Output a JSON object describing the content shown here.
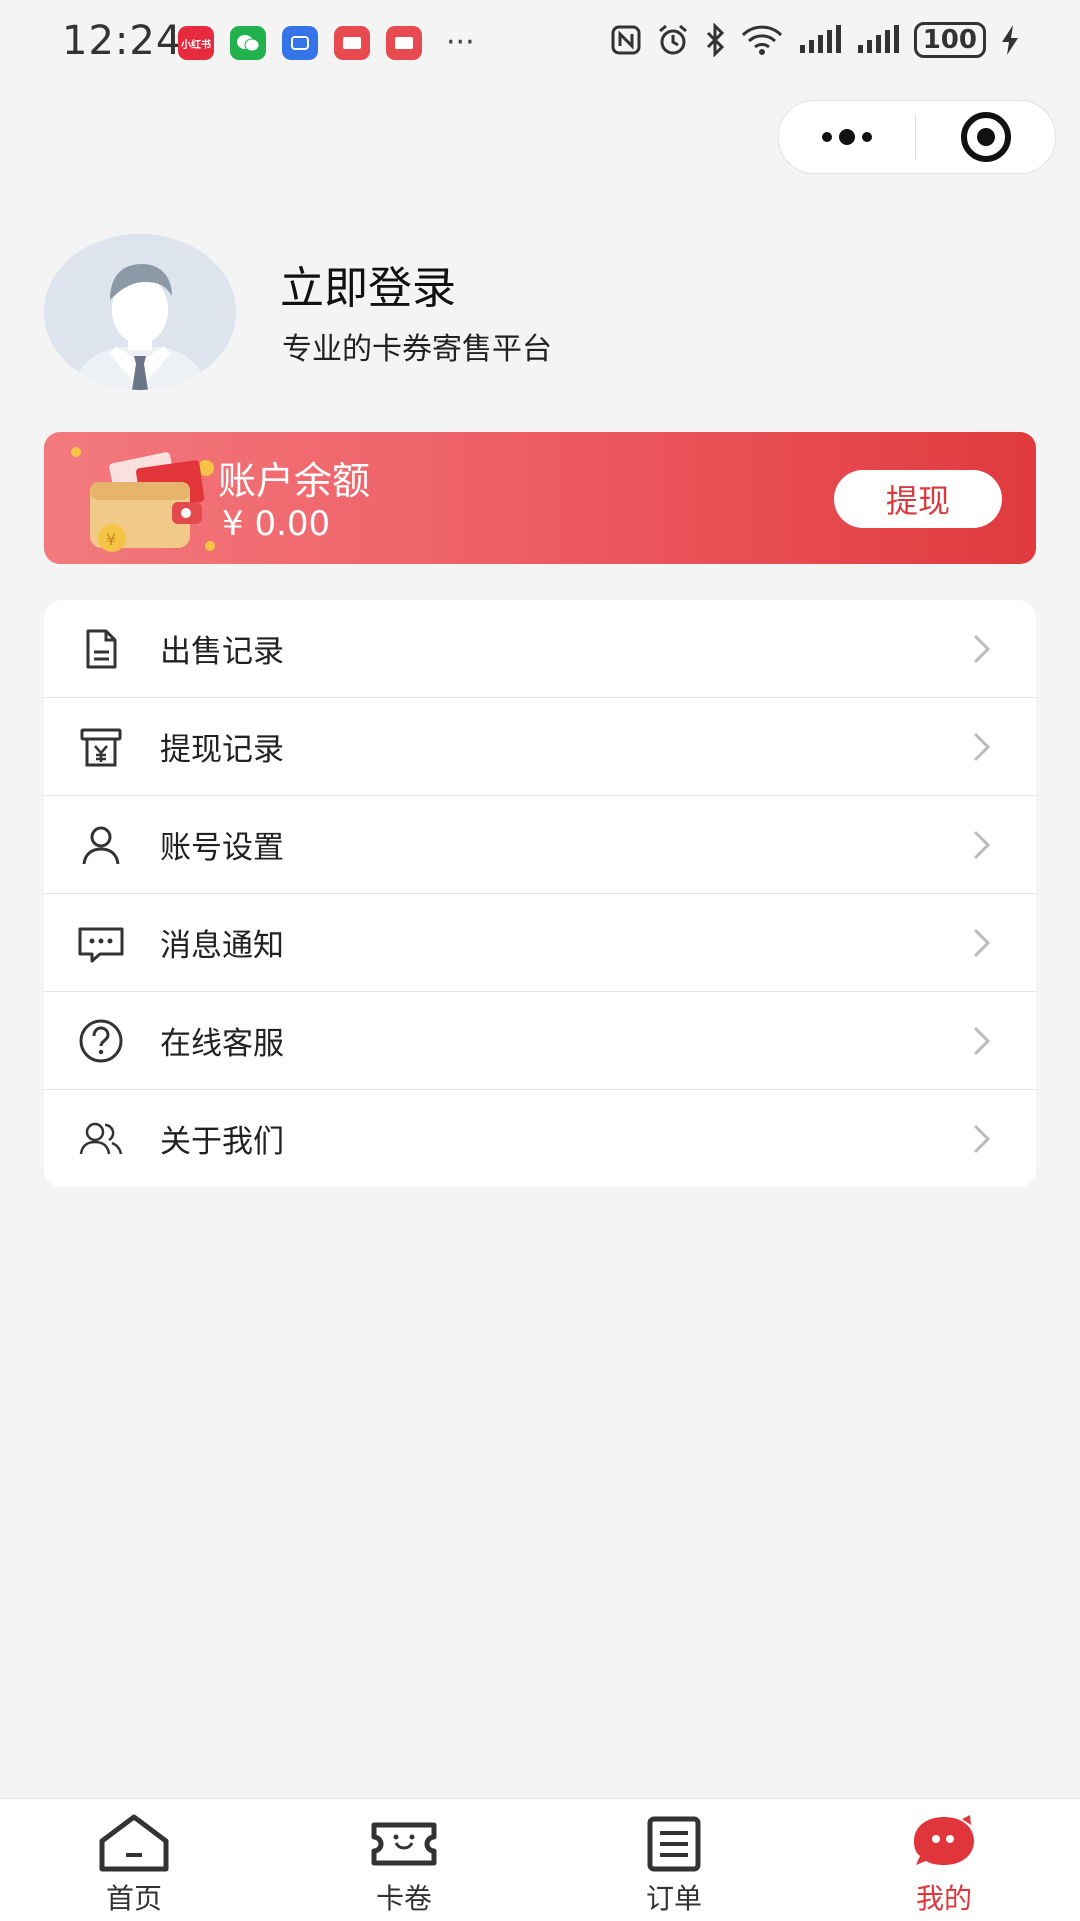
{
  "status_bar": {
    "time": "12:24",
    "app_icons": [
      {
        "name": "xiaohongshu-icon",
        "label": "小红书",
        "color": "#e52b3d"
      },
      {
        "name": "wechat-icon",
        "label": "",
        "color": "#22b14c"
      },
      {
        "name": "blue-app-icon",
        "label": "",
        "color": "#3474e8"
      },
      {
        "name": "red-app-icon-1",
        "label": "",
        "color": "#e84b4f"
      },
      {
        "name": "red-app-icon-2",
        "label": "",
        "color": "#e84b4f"
      }
    ],
    "more": "···",
    "battery": "100"
  },
  "profile": {
    "title": "立即登录",
    "subtitle": "专业的卡券寄售平台"
  },
  "balance": {
    "label": "账户余额",
    "amount": "¥ 0.00",
    "withdraw_label": "提现"
  },
  "menu": [
    {
      "label": "出售记录",
      "icon": "document-icon"
    },
    {
      "label": "提现记录",
      "icon": "yen-receipt-icon"
    },
    {
      "label": "账号设置",
      "icon": "user-icon"
    },
    {
      "label": "消息通知",
      "icon": "message-icon"
    },
    {
      "label": "在线客服",
      "icon": "help-icon"
    },
    {
      "label": "关于我们",
      "icon": "users-icon"
    }
  ],
  "tabs": [
    {
      "label": "首页",
      "icon": "home-icon",
      "active": false
    },
    {
      "label": "卡卷",
      "icon": "ticket-icon",
      "active": false
    },
    {
      "label": "订单",
      "icon": "order-icon",
      "active": false
    },
    {
      "label": "我的",
      "icon": "mine-icon",
      "active": true
    }
  ],
  "colors": {
    "accent": "#e0363b",
    "card_gradient_start": "#f27a7d",
    "card_gradient_end": "#e03a3e",
    "background": "#f4f4f4"
  }
}
